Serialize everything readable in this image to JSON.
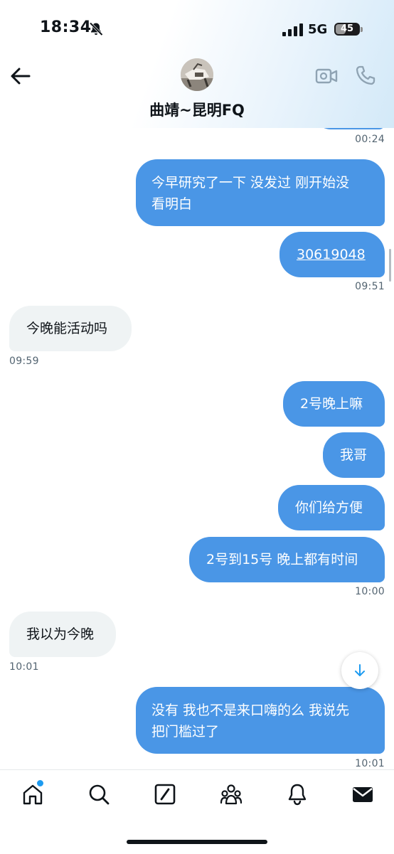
{
  "status_bar": {
    "time": "18:34",
    "network": "5G",
    "battery": "45",
    "battery_level": 0.45
  },
  "header": {
    "contact_name": "曲靖~昆明FQ"
  },
  "messages": [
    {
      "direction": "out",
      "text": "今早研究了一下 没发过 刚开始没看明白"
    },
    {
      "direction": "out",
      "text": "30619048"
    },
    {
      "direction": "in",
      "text": "今晚能活动吗"
    },
    {
      "direction": "out",
      "text": "2号晚上嘛"
    },
    {
      "direction": "out",
      "text": "我哥"
    },
    {
      "direction": "out",
      "text": "你们给方便"
    },
    {
      "direction": "out",
      "text": "2号到15号 晚上都有时间"
    },
    {
      "direction": "in",
      "text": "我以为今晚"
    },
    {
      "direction": "out",
      "text": "没有 我也不是来口嗨的么 我说先把门槛过了"
    }
  ],
  "message_lines": {
    "m0_line1": "今早研究了一下 没发过 刚开始没",
    "m0_line2": "看明白",
    "m8_line1": "没有 我也不是来口嗨的么 我说先",
    "m8_line2": "把门槛过了"
  },
  "timestamps": [
    "00:24",
    "09:51",
    "09:59",
    "10:00",
    "10:01",
    "10:01"
  ],
  "colors": {
    "outgoing_bubble": "#4a96e6",
    "incoming_bubble": "#eff3f4",
    "accent": "#1d9bf0",
    "timestamp": "#536471"
  },
  "tabbar": {
    "items": [
      "home-icon",
      "search-icon",
      "compose-icon",
      "communities-icon",
      "notifications-icon",
      "messages-icon"
    ],
    "home_has_notification": true
  }
}
